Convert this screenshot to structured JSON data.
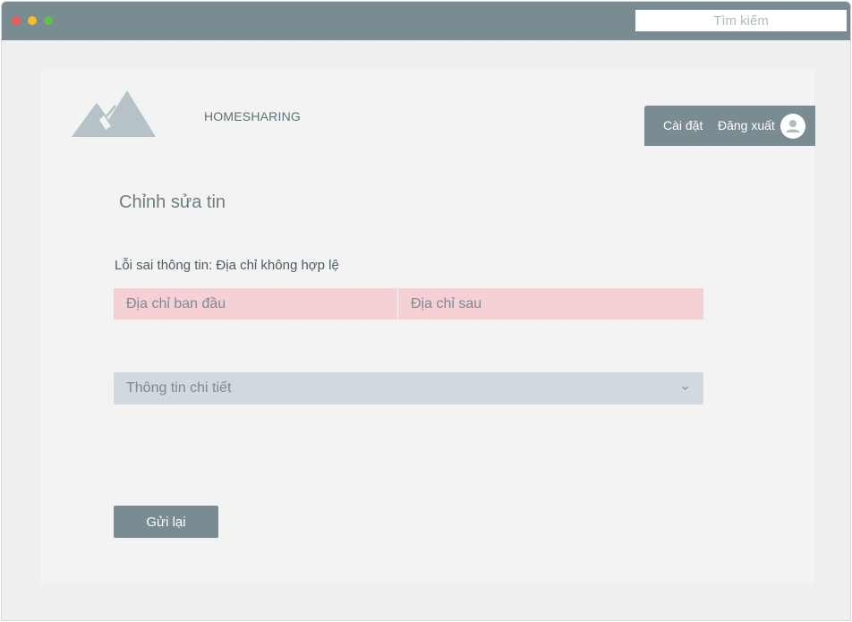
{
  "browser": {
    "search_placeholder": "Tìm kiếm",
    "traffic_lights": [
      "#ee5c5c",
      "#f2be2a",
      "#5fc24a"
    ]
  },
  "header": {
    "brand": "HOMESHARING",
    "logo_icon": "mountain-logo-icon",
    "menu": {
      "settings_label": "Cài đặt",
      "logout_label": "Đăng xuất",
      "avatar_icon": "user-avatar-icon"
    }
  },
  "form": {
    "title": "Chỉnh sửa tin",
    "error_message": "Lỗi sai thông tin: Địa chỉ không hợp lệ",
    "original_address_placeholder": "Địa chỉ ban đầu",
    "new_address_placeholder": "Địa chỉ sau",
    "details_label": "Thông tin chi tiết",
    "details_icon": "chevron-down-icon",
    "submit_label": "Gửi lại"
  },
  "colors": {
    "accent": "#7a8c91",
    "error_field": "#f5d0d5",
    "select_bg": "#d1d8de",
    "background": "#efefef"
  }
}
